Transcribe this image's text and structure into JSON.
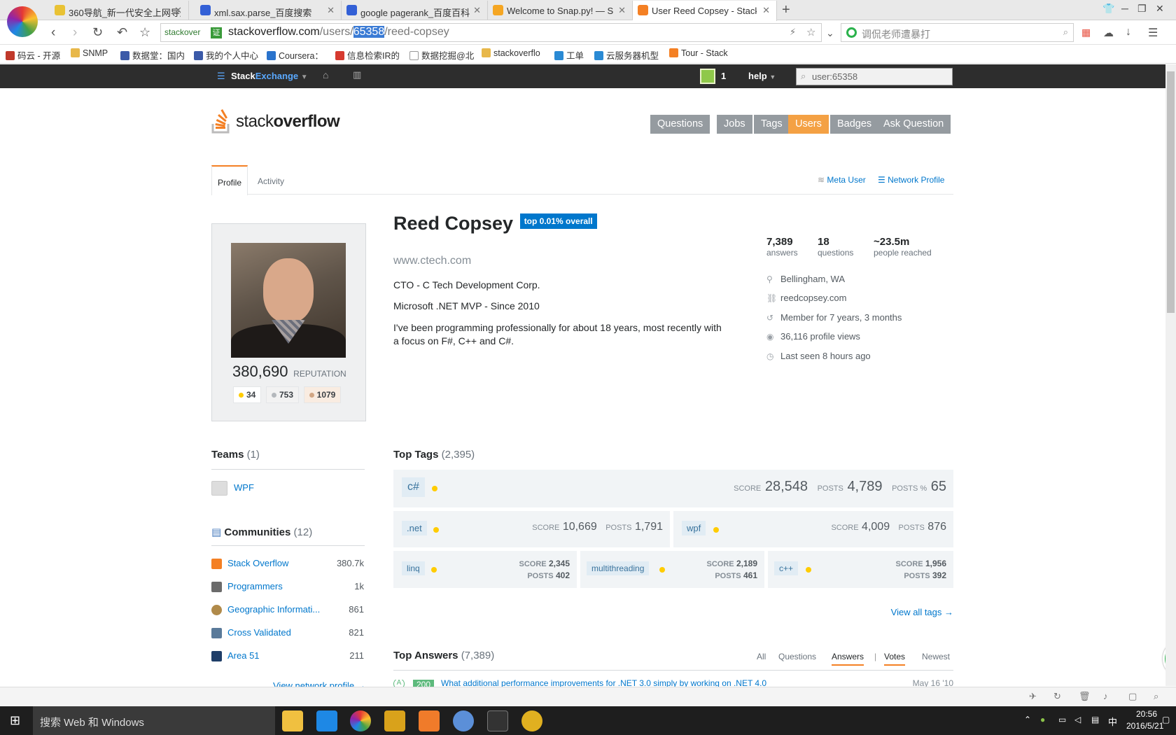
{
  "browser": {
    "tabs": [
      {
        "title": "360导航_新一代安全上网导航",
        "color": "#e9c234"
      },
      {
        "title": "xml.sax.parse_百度搜索",
        "color": "#3360d6"
      },
      {
        "title": "google pagerank_百度百科",
        "color": "#3360d6"
      },
      {
        "title": "Welcome to Snap.py! — S",
        "color": "#f5a623"
      },
      {
        "title": "User Reed Copsey - Stack",
        "color": "#f48024"
      }
    ],
    "new_tab": "+",
    "address": {
      "site_label": "stackover",
      "secure_badge": "证",
      "url_host": "stackoverflow.com",
      "url_path1": "/users/",
      "url_selected": "65358",
      "url_path2": "/reed-copsey"
    },
    "search_placeholder": "调侃老师遭暴打",
    "bookmarks": [
      {
        "label": "码云 - 开源",
        "color": "#c0392b"
      },
      {
        "label": "SNMP",
        "color": "#e8b84a"
      },
      {
        "label": "数据堂：国内",
        "color": "#3b5aa8"
      },
      {
        "label": "我的个人中心",
        "color": "#3b5aa8"
      },
      {
        "label": "Coursera：",
        "color": "#2a73cc"
      },
      {
        "label": "信息检索IR的",
        "color": "#d63a2f"
      },
      {
        "label": "数据挖掘@北",
        "color": "#bbbbbb"
      },
      {
        "label": "stackoverflo",
        "color": "#e8b84a"
      },
      {
        "label": "工单",
        "color": "#2a8ad4"
      },
      {
        "label": "云服务器机型",
        "color": "#2a8ad4"
      },
      {
        "label": "Tour - Stack",
        "color": "#f48024"
      }
    ]
  },
  "topbar": {
    "brand_a": "Stack",
    "brand_b": "Exchange",
    "rep": "1",
    "help": "help",
    "search_value": "user:65358"
  },
  "site": {
    "logo_a": "stack",
    "logo_b": "overflow",
    "nav": [
      "Questions",
      "Jobs",
      "Tags",
      "Users",
      "Badges",
      "Ask Question"
    ],
    "active_nav": "Users"
  },
  "profile_tabs": {
    "profile": "Profile",
    "activity": "Activity",
    "meta_user": "Meta User",
    "network_profile": "Network Profile"
  },
  "user": {
    "name": "Reed Copsey",
    "rank_badge": "top 0.01% overall",
    "website": "www.ctech.com",
    "bio": [
      "CTO - C Tech Development Corp.",
      "Microsoft .NET MVP - Since 2010",
      "I've been programming professionally for about 18 years, most recently with a focus on F#, C++ and C#."
    ],
    "reputation": "380,690",
    "reputation_label": "REPUTATION",
    "badges": {
      "gold": "34",
      "silver": "753",
      "bronze": "1079"
    },
    "stats": [
      {
        "value": "7,389",
        "label": "answers"
      },
      {
        "value": "18",
        "label": "questions"
      },
      {
        "value": "~23.5m",
        "label": "people reached"
      }
    ],
    "info": [
      {
        "icon": "location-icon",
        "text": "Bellingham, WA"
      },
      {
        "icon": "link-icon",
        "text": "reedcopsey.com"
      },
      {
        "icon": "history-icon",
        "text": "Member for 7 years, 3 months"
      },
      {
        "icon": "eye-icon",
        "text": "36,116 profile views"
      },
      {
        "icon": "clock-icon",
        "text": "Last seen 8 hours ago"
      }
    ]
  },
  "teams": {
    "title": "Teams",
    "count": "(1)",
    "items": [
      {
        "name": "WPF"
      }
    ]
  },
  "communities": {
    "title": "Communities",
    "count": "(12)",
    "items": [
      {
        "name": "Stack Overflow",
        "rep": "380.7k",
        "color": "#f48024"
      },
      {
        "name": "Programmers",
        "rep": "1k",
        "color": "#6b6b6b"
      },
      {
        "name": "Geographic Informati...",
        "rep": "861",
        "color": "#b08a4a"
      },
      {
        "name": "Cross Validated",
        "rep": "821",
        "color": "#5a7a9a"
      },
      {
        "name": "Area 51",
        "rep": "211",
        "color": "#1f3e68"
      }
    ],
    "view_network": "View network profile →"
  },
  "top_tags": {
    "title": "Top Tags",
    "count": "(2,395)",
    "score_label": "SCORE",
    "posts_label": "POSTS",
    "posts_pct_label": "POSTS %",
    "primary": {
      "tag": "c#",
      "score": "28,548",
      "posts": "4,789",
      "posts_pct": "65"
    },
    "secondary": [
      {
        "tag": ".net",
        "score": "10,669",
        "posts": "1,791"
      },
      {
        "tag": "wpf",
        "score": "4,009",
        "posts": "876"
      }
    ],
    "tertiary": [
      {
        "tag": "linq",
        "score": "2,345",
        "posts": "402"
      },
      {
        "tag": "multithreading",
        "score": "2,189",
        "posts": "461"
      },
      {
        "tag": "c++",
        "score": "1,956",
        "posts": "392"
      }
    ],
    "view_all": "View all tags →"
  },
  "top_answers": {
    "title": "Top Answers",
    "count": "(7,389)",
    "filters": [
      "All",
      "Questions",
      "Answers"
    ],
    "sorts": [
      "Votes",
      "Newest"
    ],
    "first_row_text": "What additional performance improvements for .NET 3.0 simply by working on .NET 4.0",
    "first_row_score": "200",
    "first_row_date": "May 16 '10"
  },
  "taskbar": {
    "search": "搜索 Web 和 Windows",
    "time": "20:56",
    "date": "2016/5/21",
    "ime": "中"
  },
  "colors": {
    "accent": "#f48024",
    "link": "#0077cc",
    "rank_badge": "#0077cc"
  }
}
